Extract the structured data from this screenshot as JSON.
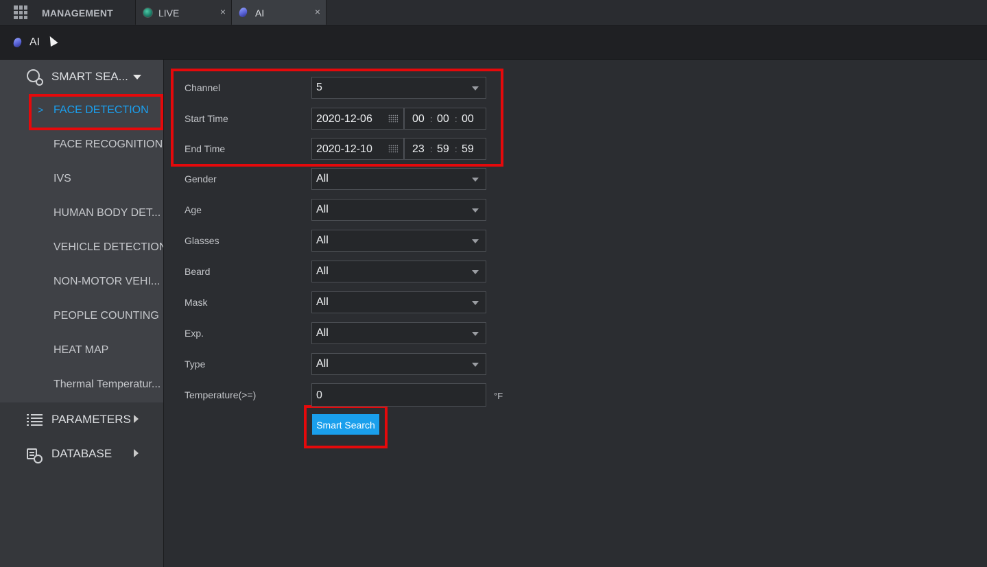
{
  "tabs": {
    "management": "MANAGEMENT",
    "live": "LIVE",
    "ai": "AI",
    "close_glyph": "×"
  },
  "breadcrumb": {
    "label": "AI"
  },
  "sidebar": {
    "smart_search": "SMART SEA...",
    "items": [
      "FACE DETECTION",
      "FACE RECOGNITION",
      "IVS",
      "HUMAN BODY DET...",
      "VEHICLE DETECTION",
      "NON-MOTOR VEHI...",
      "PEOPLE COUNTING",
      "HEAT MAP",
      "Thermal Temperatur..."
    ],
    "active_chevron": ">",
    "parameters": "PARAMETERS",
    "database": "DATABASE"
  },
  "form": {
    "channel": {
      "label": "Channel",
      "value": "5"
    },
    "start_time": {
      "label": "Start Time",
      "date": "2020-12-06",
      "hh": "00",
      "mm": "00",
      "ss": "00"
    },
    "end_time": {
      "label": "End Time",
      "date": "2020-12-10",
      "hh": "23",
      "mm": "59",
      "ss": "59"
    },
    "gender": {
      "label": "Gender",
      "value": "All"
    },
    "age": {
      "label": "Age",
      "value": "All"
    },
    "glasses": {
      "label": "Glasses",
      "value": "All"
    },
    "beard": {
      "label": "Beard",
      "value": "All"
    },
    "mask": {
      "label": "Mask",
      "value": "All"
    },
    "expression": {
      "label": "Exp.",
      "value": "All"
    },
    "type": {
      "label": "Type",
      "value": "All"
    },
    "temperature": {
      "label": "Temperature(>=)",
      "value": "0",
      "unit": "°F"
    },
    "time_separator": ":",
    "search_button": "Smart Search"
  },
  "colors": {
    "accent": "#1aa0f0",
    "highlight_box": "#e5090b",
    "background": "#2b2d31"
  }
}
